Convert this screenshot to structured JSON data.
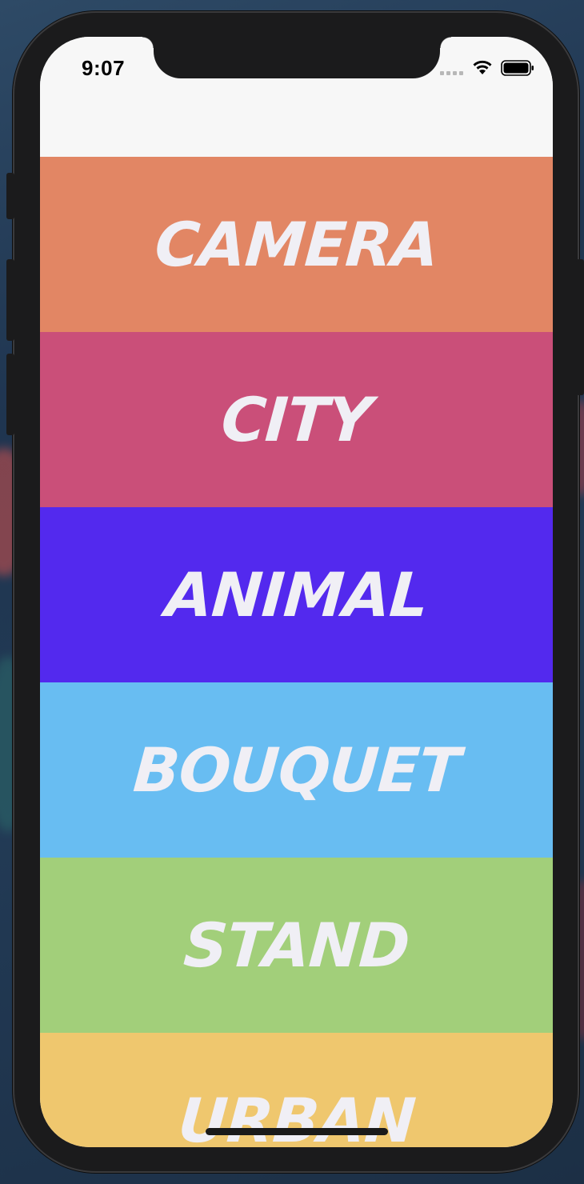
{
  "status_bar": {
    "time": "9:07",
    "signal_icon": "cellular-signal-icon",
    "wifi_icon": "wifi-icon",
    "battery_icon": "battery-icon"
  },
  "categories": [
    {
      "label": "CAMERA",
      "color": "#e28664"
    },
    {
      "label": "CITY",
      "color": "#ca4f79"
    },
    {
      "label": "ANIMAL",
      "color": "#5329ee"
    },
    {
      "label": "BOUQUET",
      "color": "#68bdf2"
    },
    {
      "label": "STAND",
      "color": "#a2cf7a"
    },
    {
      "label": "URBAN",
      "color": "#efc76e"
    }
  ],
  "colors": {
    "label_text": "#f0eff5",
    "header_background": "#f7f7f7",
    "device_frame": "#1b1b1c"
  }
}
